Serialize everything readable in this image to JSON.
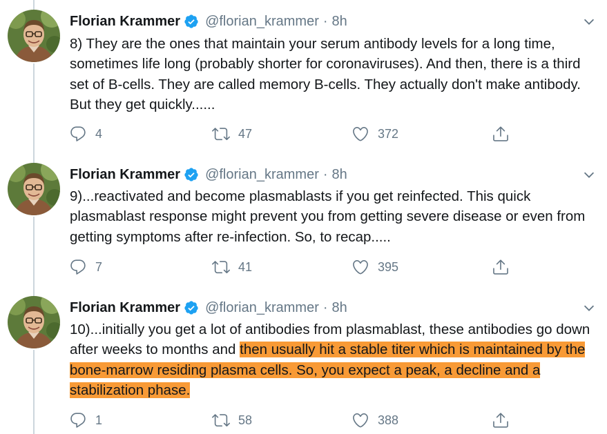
{
  "colors": {
    "verified": "#1da1f2",
    "secondary_text": "#657786",
    "highlight": "#f89a36",
    "thread_line": "#ccd6dd"
  },
  "icons": {
    "verified": "verified-badge-icon",
    "more": "chevron-down-icon",
    "reply": "reply-icon",
    "retweet": "retweet-icon",
    "like": "heart-icon",
    "share": "share-icon"
  },
  "tweets": [
    {
      "author": "Florian Krammer",
      "handle": "@florian_krammer",
      "separator": "·",
      "time": "8h",
      "text_plain": "8) They are the ones that maintain your serum antibody levels for a long time, sometimes life long (probably shorter  for coronaviruses). And then, there is a third set of B-cells. They are called memory B-cells. They actually don't make antibody. But they get quickly......",
      "text_highlighted": "",
      "replies": "4",
      "retweets": "47",
      "likes": "372"
    },
    {
      "author": "Florian Krammer",
      "handle": "@florian_krammer",
      "separator": "·",
      "time": "8h",
      "text_plain": "9)...reactivated and become plasmablasts if you get reinfected. This quick plasmablast response might prevent you from getting severe disease or even from getting symptoms after re-infection. So, to recap.....",
      "text_highlighted": "",
      "replies": "7",
      "retweets": "41",
      "likes": "395"
    },
    {
      "author": "Florian Krammer",
      "handle": "@florian_krammer",
      "separator": "·",
      "time": "8h",
      "text_plain": "10)...initially you get a lot of antibodies from plasmablast, these antibodies go down after weeks to months and ",
      "text_highlighted": "then usually hit a stable titer which is maintained by the bone-marrow residing plasma cells. So, you expect a peak, a decline and a stabilization phase.",
      "replies": "1",
      "retweets": "58",
      "likes": "388"
    }
  ]
}
